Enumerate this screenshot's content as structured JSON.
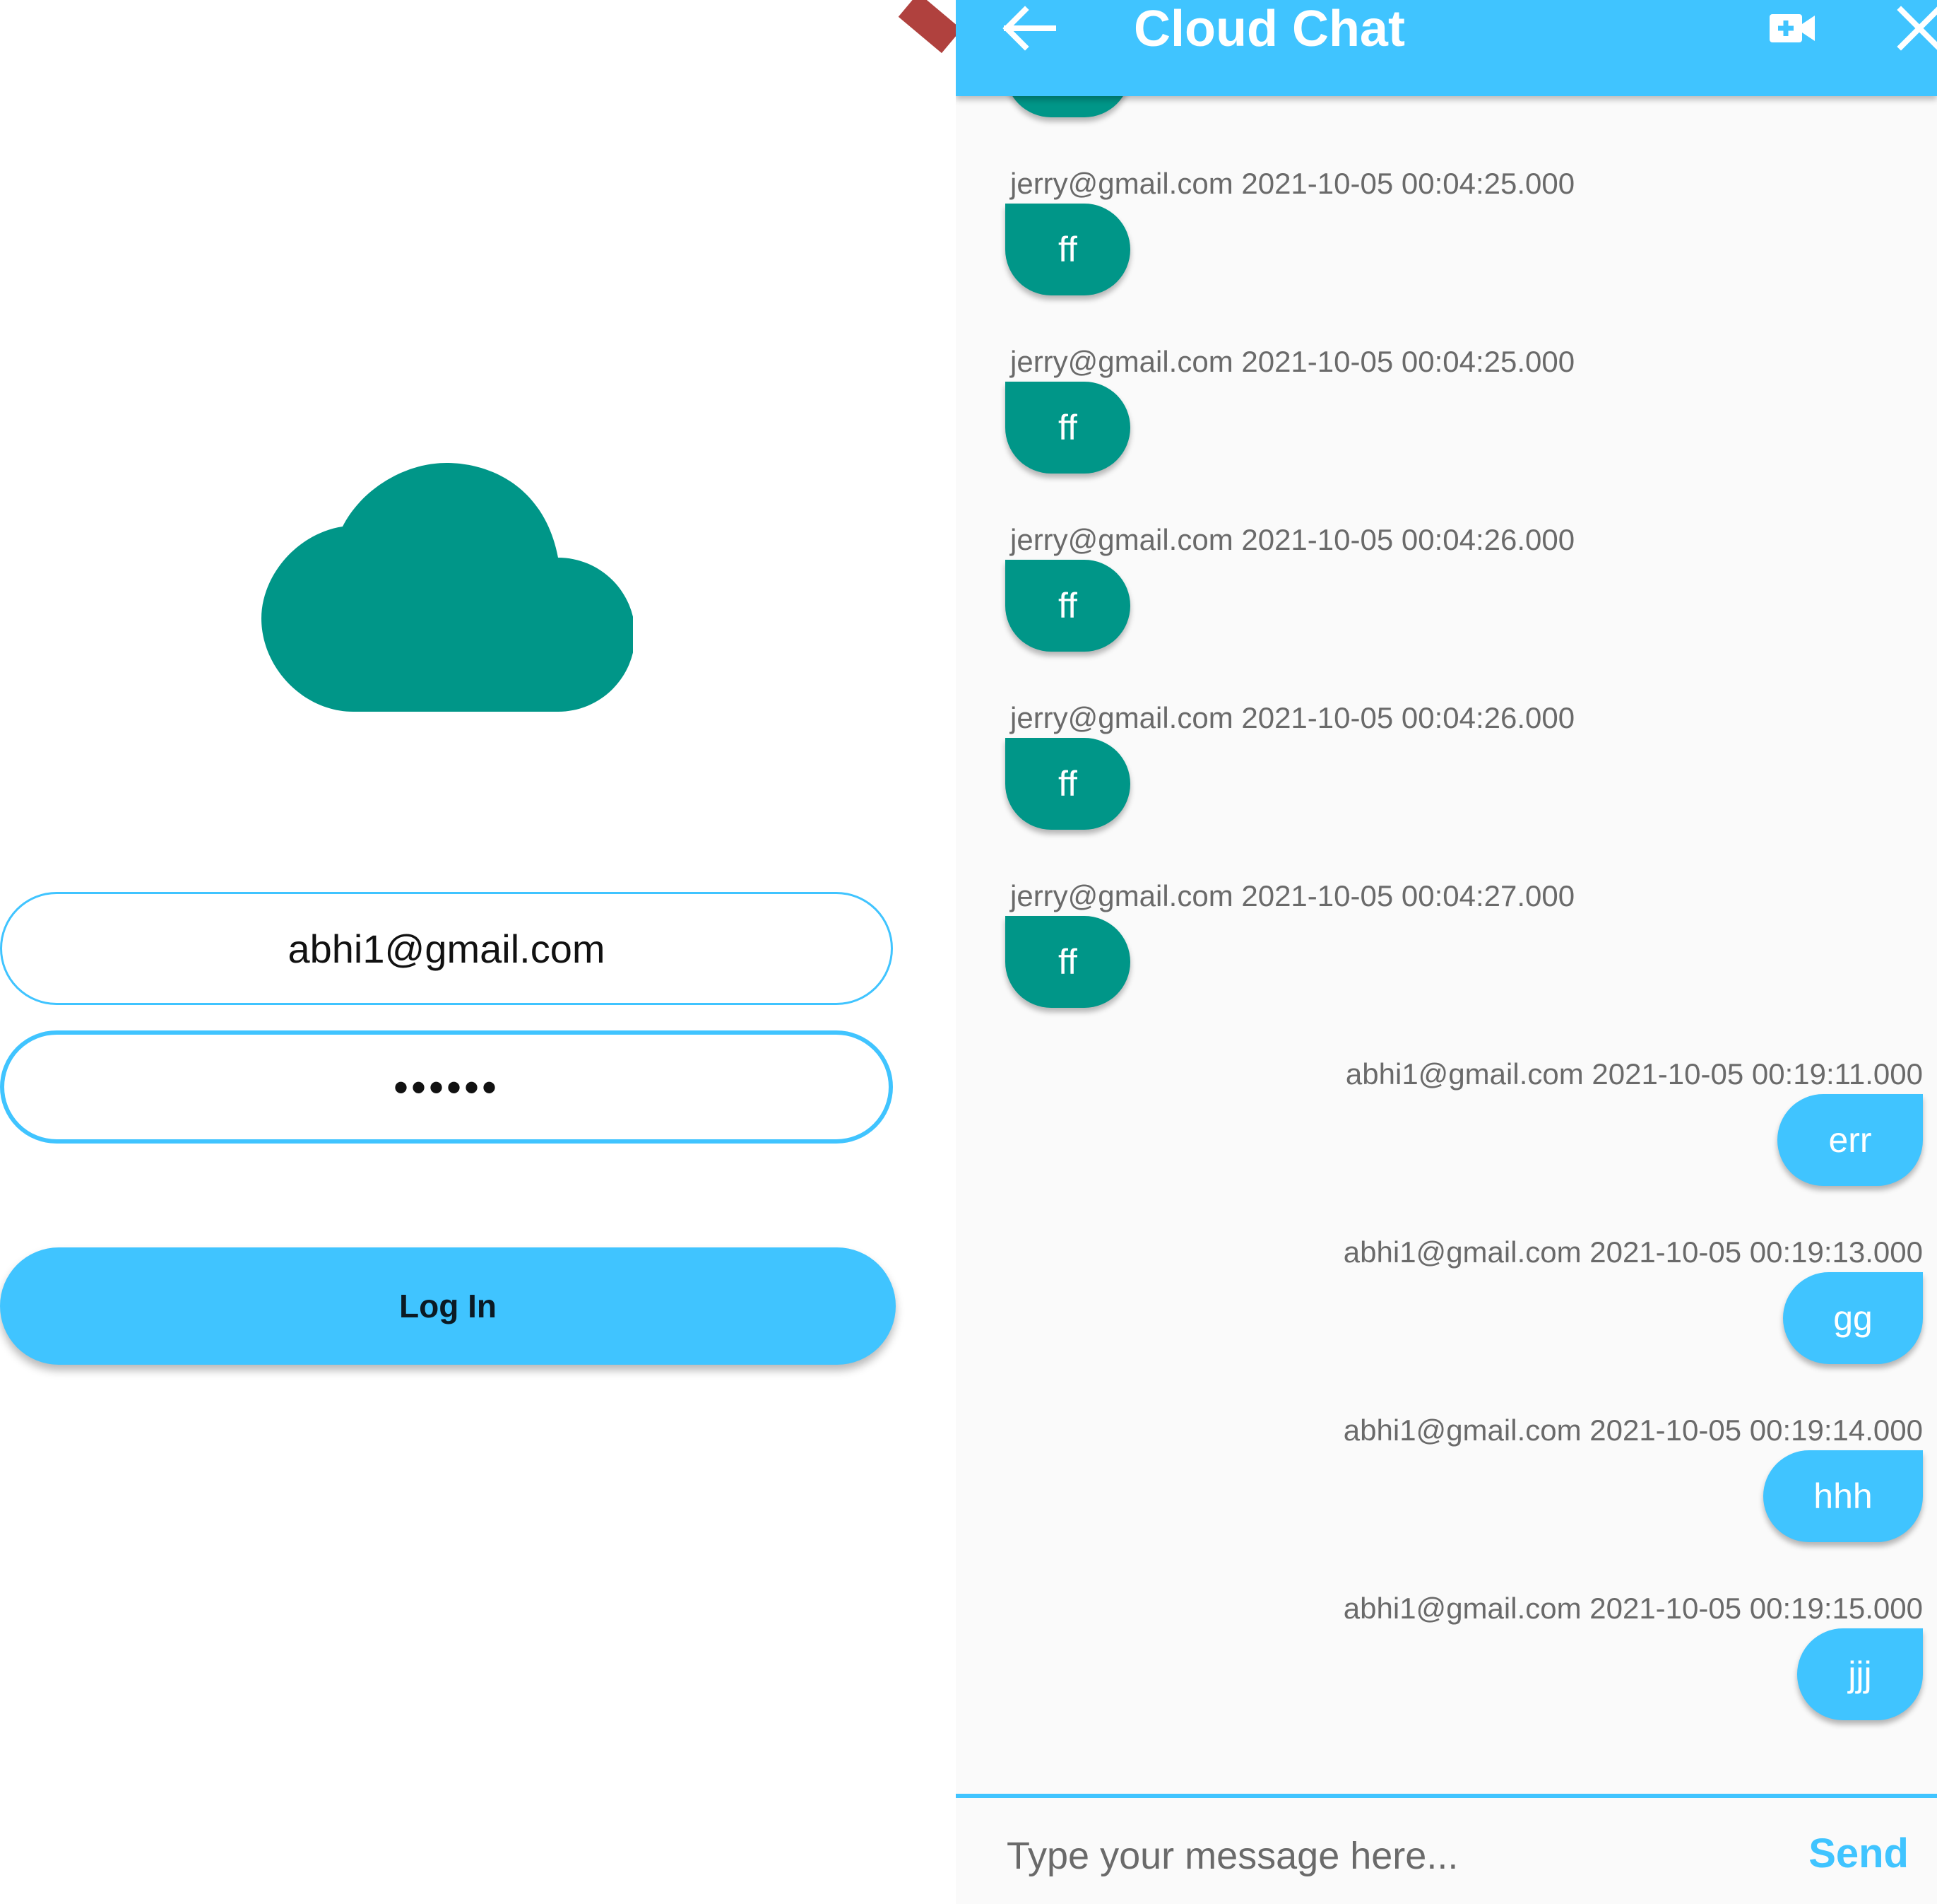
{
  "login": {
    "email_value": "abhi1@gmail.com",
    "password_masked": "••••••",
    "login_label": "Log In"
  },
  "chat": {
    "title": "Cloud Chat",
    "messages": [
      {
        "sender": "jerry@gmail.com",
        "time": "2021-10-05 00:04:25.000",
        "meta": "jerry@gmail.com 2021-10-05 00:04:25.000",
        "text": "ff",
        "mine": false
      },
      {
        "sender": "jerry@gmail.com",
        "time": "2021-10-05 00:04:25.000",
        "meta": "jerry@gmail.com 2021-10-05 00:04:25.000",
        "text": "ff",
        "mine": false
      },
      {
        "sender": "jerry@gmail.com",
        "time": "2021-10-05 00:04:26.000",
        "meta": "jerry@gmail.com 2021-10-05 00:04:26.000",
        "text": "ff",
        "mine": false
      },
      {
        "sender": "jerry@gmail.com",
        "time": "2021-10-05 00:04:26.000",
        "meta": "jerry@gmail.com 2021-10-05 00:04:26.000",
        "text": "ff",
        "mine": false
      },
      {
        "sender": "jerry@gmail.com",
        "time": "2021-10-05 00:04:27.000",
        "meta": "jerry@gmail.com 2021-10-05 00:04:27.000",
        "text": "ff",
        "mine": false
      },
      {
        "sender": "abhi1@gmail.com",
        "time": "2021-10-05 00:19:11.000",
        "meta": "abhi1@gmail.com 2021-10-05 00:19:11.000",
        "text": "err",
        "mine": true
      },
      {
        "sender": "abhi1@gmail.com",
        "time": "2021-10-05 00:19:13.000",
        "meta": "abhi1@gmail.com 2021-10-05 00:19:13.000",
        "text": "gg",
        "mine": true
      },
      {
        "sender": "abhi1@gmail.com",
        "time": "2021-10-05 00:19:14.000",
        "meta": "abhi1@gmail.com 2021-10-05 00:19:14.000",
        "text": "hhh",
        "mine": true
      },
      {
        "sender": "abhi1@gmail.com",
        "time": "2021-10-05 00:19:15.000",
        "meta": "abhi1@gmail.com 2021-10-05 00:19:15.000",
        "text": "jjj",
        "mine": true
      }
    ],
    "input_placeholder": "Type your message here...",
    "send_label": "Send"
  },
  "icons": {
    "back": "arrow-back-icon",
    "video": "video-call-icon",
    "close": "close-icon",
    "logo": "cloud-icon"
  },
  "colors": {
    "accent": "#40c4ff",
    "incoming_bubble": "#009688",
    "logo": "#009688"
  }
}
